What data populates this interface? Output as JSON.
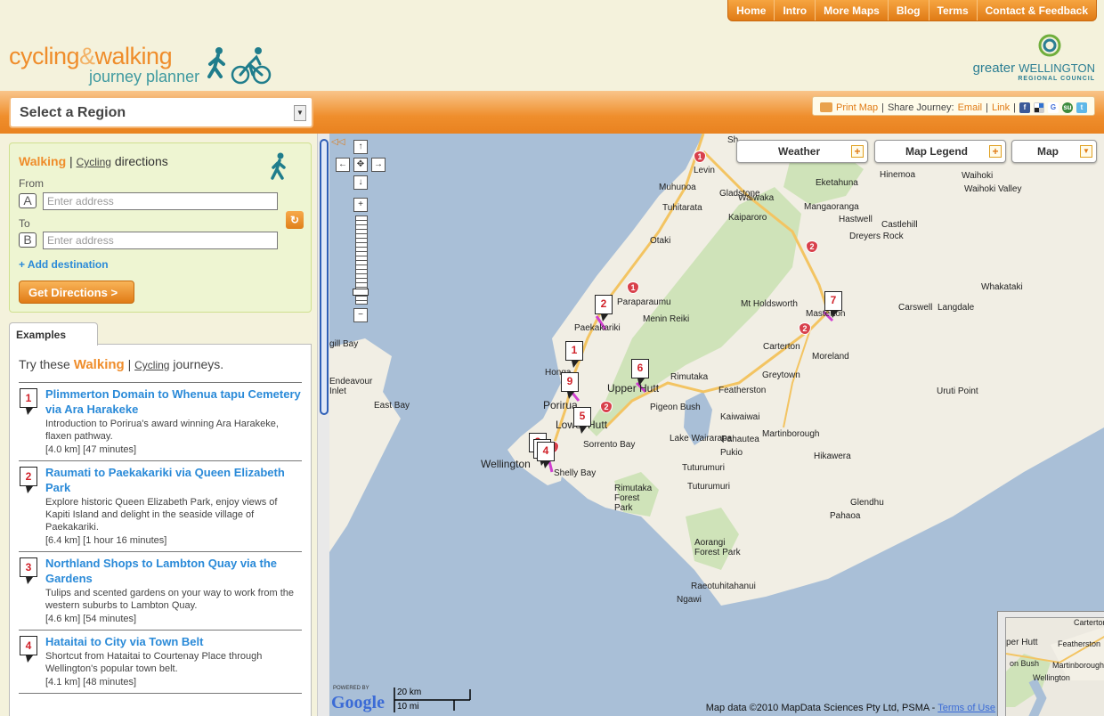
{
  "topnav": [
    "Home",
    "Intro",
    "More Maps",
    "Blog",
    "Terms",
    "Contact & Feedback"
  ],
  "logo": {
    "part1": "cycling",
    "amp": "&",
    "part2": "walking",
    "line2": "journey planner"
  },
  "gw_logo": {
    "greater": "greater",
    "wellington": "WELLINGTON",
    "council": "REGIONAL COUNCIL"
  },
  "region_select": {
    "label": "Select a Region"
  },
  "share": {
    "print": "Print Map",
    "sep1": "|",
    "share_label": "Share Journey:",
    "email": "Email",
    "link": "Link"
  },
  "directions": {
    "walking": "Walking",
    "sep": "|",
    "cycling": "Cycling",
    "rest": "directions",
    "from_label": "From",
    "to_label": "To",
    "a": "A",
    "b": "B",
    "from_placeholder": "Enter address",
    "to_placeholder": "Enter address",
    "add_destination": "+ Add destination",
    "get_directions": "Get Directions >"
  },
  "examples": {
    "tab": "Examples",
    "try": "Try these",
    "walking": "Walking",
    "sep": "|",
    "cycling": "Cycling",
    "journeys": "journeys.",
    "items": [
      {
        "num": "1",
        "title": "Plimmerton Domain to Whenua tapu Cemetery via Ara Harakeke",
        "desc": "Introduction to Porirua's award winning Ara Harakeke, flaxen pathway.",
        "meta": "[4.0 km] [47 minutes]"
      },
      {
        "num": "2",
        "title": "Raumati to Paekakariki via Queen Elizabeth Park",
        "desc": "Explore historic Queen Elizabeth Park, enjoy views of Kapiti Island and delight in the seaside village of Paekakariki.",
        "meta": "[6.4 km] [1 hour 16 minutes]"
      },
      {
        "num": "3",
        "title": "Northland Shops to Lambton Quay via the Gardens",
        "desc": "Tulips and scented gardens on your way to work from the western suburbs to Lambton Quay.",
        "meta": "[4.6 km] [54 minutes]"
      },
      {
        "num": "4",
        "title": "Hataitai to City via Town Belt",
        "desc": "Shortcut from Hataitai to Courtenay Place through Wellington's popular town belt.",
        "meta": "[4.1 km] [48 minutes]"
      }
    ]
  },
  "map": {
    "weather": "Weather",
    "legend": "Map Legend",
    "maptype": "Map",
    "scale_km": "20 km",
    "scale_mi": "10 mi",
    "powered": "POWERED BY",
    "google": "Google",
    "data": "Map data ©2010 MapData Sciences Pty Ltd, PSMA -",
    "terms": "Terms of Use",
    "places": [
      {
        "name": "Levin"
      },
      {
        "name": "Muhunoa"
      },
      {
        "name": "Gladstone"
      },
      {
        "name": "Waiwaka"
      },
      {
        "name": "Eketahuna"
      },
      {
        "name": "Hinemoa"
      },
      {
        "name": "Waihoki"
      },
      {
        "name": "Waihoki Valley"
      },
      {
        "name": "Tuhitarata"
      },
      {
        "name": "Kaiparoro"
      },
      {
        "name": "Mangaoranga"
      },
      {
        "name": "Hastwell"
      },
      {
        "name": "Castlehill"
      },
      {
        "name": "Dreyers Rock"
      },
      {
        "name": "Otaki"
      },
      {
        "name": "Whakataki"
      },
      {
        "name": "Paraparaumu"
      },
      {
        "name": "Menin Reiki"
      },
      {
        "name": "Mt Holdsworth"
      },
      {
        "name": "Masterton"
      },
      {
        "name": "Carswell"
      },
      {
        "name": "Langdale"
      },
      {
        "name": "Paekakariki"
      },
      {
        "name": "Carterton"
      },
      {
        "name": "Moreland"
      },
      {
        "name": "Greytown"
      },
      {
        "name": "Rimutaka"
      },
      {
        "name": "Featherston"
      },
      {
        "name": "Uruti Point"
      },
      {
        "name": "Upper Hutt"
      },
      {
        "name": "Porirua"
      },
      {
        "name": "Lower Hutt"
      },
      {
        "name": "Pigeon Bush"
      },
      {
        "name": "Kaiwaiwai"
      },
      {
        "name": "Martinborough"
      },
      {
        "name": "Lake Wairarapa"
      },
      {
        "name": "Pahautea"
      },
      {
        "name": "Hikawera"
      },
      {
        "name": "Pukio"
      },
      {
        "name": "Sorrento Bay"
      },
      {
        "name": "Wellington"
      },
      {
        "name": "Shelly Bay"
      },
      {
        "name": "Tuturumuri"
      },
      {
        "name": "Rimutaka Forest Park"
      },
      {
        "name": "Tuturumuri"
      },
      {
        "name": "Glendhu"
      },
      {
        "name": "Pahaoa"
      },
      {
        "name": "Aorangi Forest Park"
      },
      {
        "name": "Raeotuhitahanui"
      },
      {
        "name": "Ngawi"
      },
      {
        "name": "Endeavour Inlet"
      },
      {
        "name": "East Bay"
      },
      {
        "name": "Honga"
      },
      {
        "name": "Sh"
      },
      {
        "name": "gill Bay"
      }
    ],
    "markers": [
      "1",
      "2",
      "3",
      "4",
      "5",
      "6",
      "7",
      "8",
      "9"
    ],
    "highways": [
      "1",
      "2",
      "1",
      "2",
      "2",
      "2"
    ],
    "overview_places": [
      {
        "name": "Carterton"
      },
      {
        "name": "per Hutt"
      },
      {
        "name": "Featherston"
      },
      {
        "name": "on Bush"
      },
      {
        "name": "Martinborough"
      },
      {
        "name": "Wellington"
      }
    ]
  }
}
